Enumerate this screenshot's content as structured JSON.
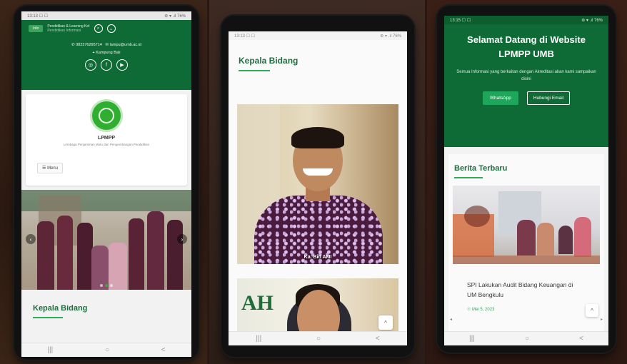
{
  "colors": {
    "brand_green": "#0f6b35",
    "accent_green": "#2fae5a",
    "button_green": "#1ea75a"
  },
  "screen1": {
    "status_time": "13:13 ☐ ☐",
    "status_icons": "⊛ ▾ .ıl 76%",
    "header_pill": "Info",
    "header_title": "Pendidikan & Learning Ket",
    "header_subtitle": "Pendidikan Informasi",
    "phone": "082376295714",
    "email": "lampu@umb.ac.id",
    "address": "Kampung Bali",
    "site_title": "LPMPP",
    "site_subtitle": "Lembaga Penjaminan Mutu dan Pengembangan Pendidikan",
    "menu_label": "Menu",
    "section_title": "Kepala Bidang",
    "nav_icons": [
      "|||",
      "○",
      "<"
    ]
  },
  "screen2": {
    "status_time": "13:13 ☐ ☐",
    "status_icons": "⊛ ▾ .ıl 76%",
    "section_title": "Kepala Bidang",
    "photo_caption": "Ka. Bid AMI",
    "partial_logo_text": "AH",
    "scroll_top": "^",
    "nav_icons": [
      "|||",
      "○",
      "<"
    ]
  },
  "screen3": {
    "status_time": "13:15 ☐ ☐",
    "status_icons": "⊛ ▾ .ıl 76%",
    "hero_title": "Selamat Datang di Website LPMPP UMB",
    "hero_subtitle": "Semua Informasi yang berkaitan dengan Akreditasi akan kami sampaikan disini",
    "whatsapp_button": "WhatsApp",
    "email_button": "Hubungi Email",
    "news_section_title": "Berita Terbaru",
    "news_title": "SPI Lakukan Audit Bidang Keuangan di UM Bengkulu",
    "news_date": "☉ Mei 5, 2023",
    "scroll_top": "^",
    "nav_icons": [
      "|||",
      "○",
      "<"
    ]
  }
}
